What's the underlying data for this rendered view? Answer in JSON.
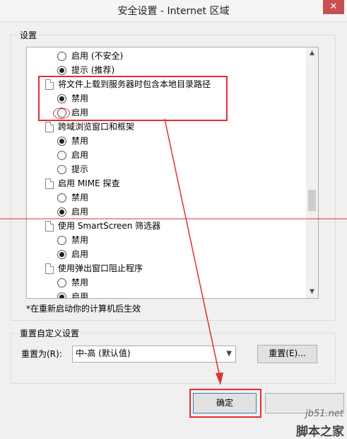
{
  "window": {
    "title": "安全设置 - Internet 区域",
    "close_glyph": "✕"
  },
  "settings_group": {
    "label": "设置"
  },
  "list": {
    "rows": [
      {
        "type": "option",
        "label": "启用 (不安全)",
        "checked": false
      },
      {
        "type": "option",
        "label": "提示 (推荐)",
        "checked": true
      },
      {
        "type": "category",
        "label": "将文件上载到服务器时包含本地目录路径"
      },
      {
        "type": "option",
        "label": "禁用",
        "checked": true
      },
      {
        "type": "option",
        "label": "启用",
        "checked": false
      },
      {
        "type": "category",
        "label": "跨域浏览窗口和框架"
      },
      {
        "type": "option",
        "label": "禁用",
        "checked": true
      },
      {
        "type": "option",
        "label": "启用",
        "checked": false
      },
      {
        "type": "option",
        "label": "提示",
        "checked": false
      },
      {
        "type": "category",
        "label": "启用 MIME 探查"
      },
      {
        "type": "option",
        "label": "禁用",
        "checked": false
      },
      {
        "type": "option",
        "label": "启用",
        "checked": true
      },
      {
        "type": "category",
        "label": "使用 SmartScreen 筛选器"
      },
      {
        "type": "option",
        "label": "禁用",
        "checked": false
      },
      {
        "type": "option",
        "label": "启用",
        "checked": true
      },
      {
        "type": "category",
        "label": "使用弹出窗口阻止程序"
      },
      {
        "type": "option",
        "label": "禁用",
        "checked": false
      },
      {
        "type": "option",
        "label": "启用",
        "checked": true
      }
    ]
  },
  "note": "*在重新启动你的计算机后生效",
  "reset_group": {
    "label": "重置自定义设置",
    "reset_to_label": "重置为(R):",
    "selected_value": "中-高 (默认值)",
    "reset_button": "重置(E)..."
  },
  "buttons": {
    "ok": "确定"
  },
  "watermark": {
    "site": "jb51.net",
    "name": "脚本之家"
  },
  "colors": {
    "highlight": "#e03030",
    "close_button": "#c75050"
  }
}
